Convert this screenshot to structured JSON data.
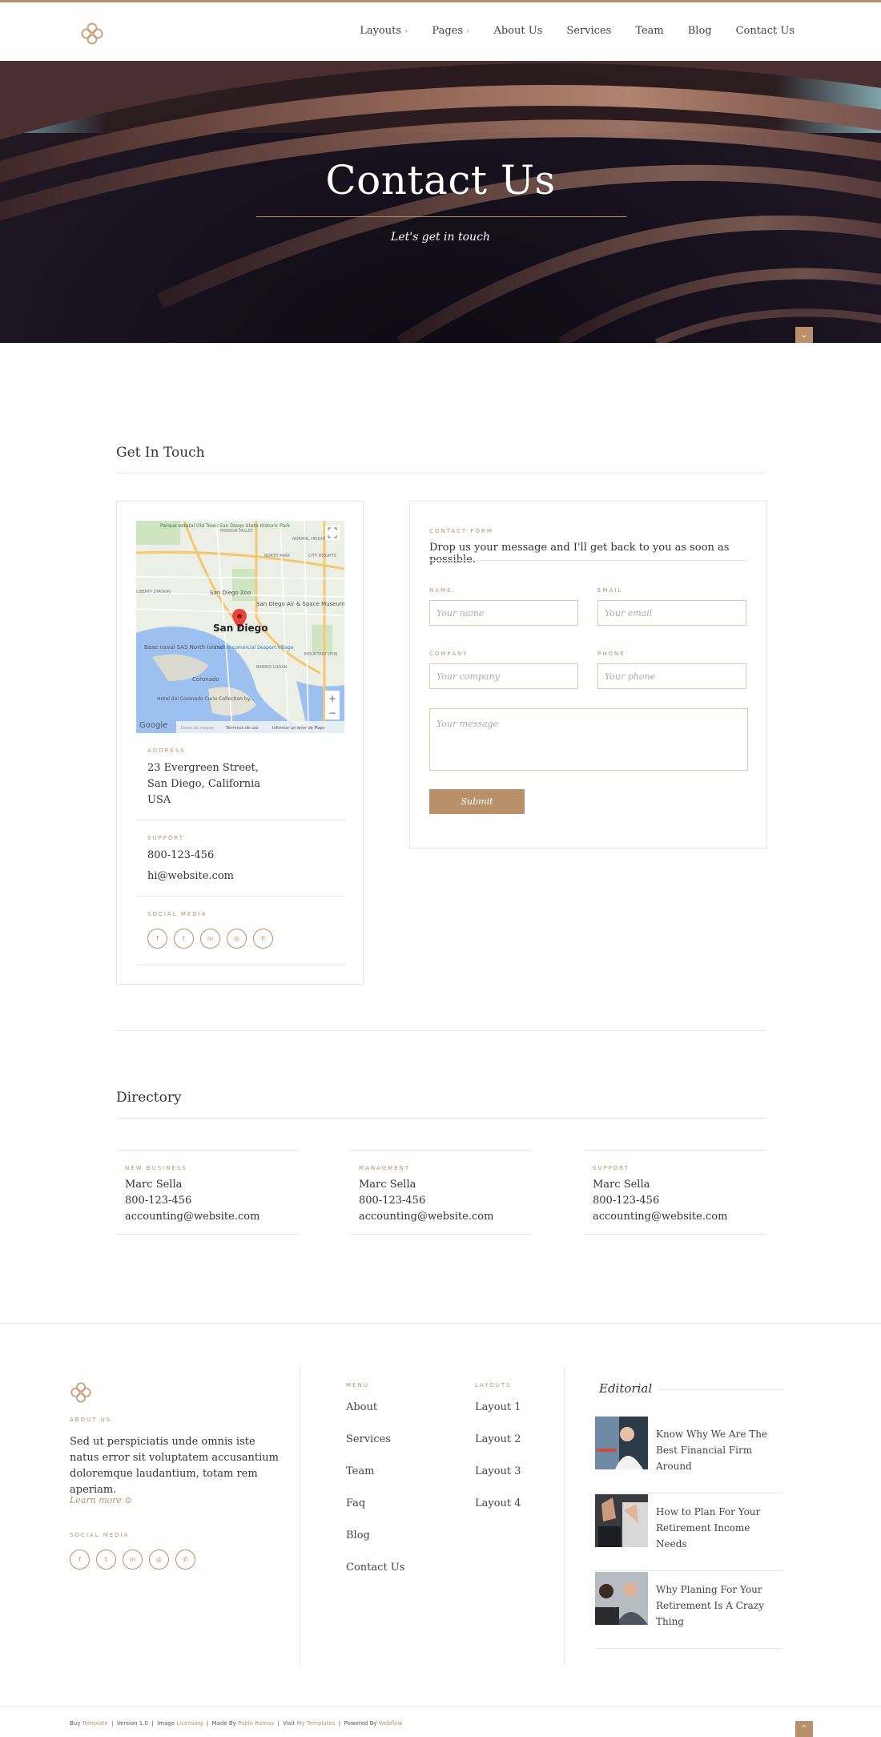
{
  "nav": {
    "items": [
      {
        "label": "Layouts",
        "has_chevron": true
      },
      {
        "label": "Pages",
        "has_chevron": true
      },
      {
        "label": "About Us"
      },
      {
        "label": "Services"
      },
      {
        "label": "Team"
      },
      {
        "label": "Blog"
      },
      {
        "label": "Contact Us"
      }
    ],
    "chevron": "›"
  },
  "hero": {
    "title": "Contact Us",
    "subtitle": "Let's get in touch",
    "down_icon": "chevron-down-icon"
  },
  "get_in_touch": {
    "title": "Get In Touch",
    "map": {
      "city": "San Diego",
      "labels": [
        "Parque estatal Old Town San Diego State Historic Park",
        "MISSION VALLEY",
        "NORMAL HEIGHTS",
        "NORTH PARK",
        "CITY HEIGHTS",
        "LIBERTY STATION",
        "San Diego Zoo",
        "San Diego Air & Space Museum",
        "Base naval SAS North Island",
        "Centro comercial Seaport Village",
        "Coronado",
        "Hotel del Coronado Curio Collection by...",
        "BARRIO LOGAN",
        "MOUNTAIN VIEW"
      ],
      "google": "Google",
      "footer_links": [
        "Datos de mapas",
        "Términos de uso",
        "Informar un error de Maps"
      ],
      "zoom_in": "+",
      "zoom_out": "−"
    },
    "address": {
      "label": "Address",
      "line1": "23 Evergreen Street,",
      "line2": "San Diego, California",
      "line3": "USA"
    },
    "support": {
      "label": "Support",
      "phone": "800-123-456",
      "email": "hi@website.com"
    },
    "social": {
      "label": "Social Media",
      "icons": [
        {
          "name": "facebook-icon",
          "glyph": "f"
        },
        {
          "name": "twitter-icon",
          "glyph": "t"
        },
        {
          "name": "linkedin-icon",
          "glyph": "in"
        },
        {
          "name": "instagram-icon",
          "glyph": "◎"
        },
        {
          "name": "whatsapp-icon",
          "glyph": "✆"
        }
      ]
    }
  },
  "contact_form": {
    "label": "Contact Form",
    "intro": "Drop us your message and I'll get back to you as soon as possible.",
    "name_label": "Name:",
    "name_placeholder": "Your name",
    "email_label": "Email",
    "email_placeholder": "Your email",
    "company_label": "Company",
    "company_placeholder": "Your company",
    "phone_label": "Phone",
    "phone_placeholder": "Your phone",
    "message_placeholder": "Your message",
    "submit": "Submit"
  },
  "directory": {
    "title": "Directory",
    "columns": [
      {
        "label": "New Business",
        "name": "Marc Sella",
        "phone": "800-123-456",
        "email": "accounting@website.com"
      },
      {
        "label": "Managment",
        "name": "Marc Sella",
        "phone": "800-123-456",
        "email": "accounting@website.com"
      },
      {
        "label": "Support",
        "name": "Marc Sella",
        "phone": "800-123-456",
        "email": "accounting@website.com"
      }
    ]
  },
  "footer": {
    "about": {
      "label": "About Us",
      "text": "Sed ut perspiciatis unde omnis iste natus error sit voluptatem accusantium doloremque laudantium, totam rem aperiam.",
      "learn_more": "Learn more ⊙"
    },
    "social_label": "Social Media",
    "menu": {
      "label": "Menu",
      "items": [
        "About",
        "Services",
        "Team",
        "Faq",
        "Blog",
        "Contact Us"
      ]
    },
    "layouts": {
      "label": "Layouts",
      "items": [
        "Layout 1",
        "Layout 2",
        "Layout 3",
        "Layout 4"
      ]
    },
    "editorial": {
      "title": "Editorial",
      "posts": [
        {
          "title": "Know Why We Are The Best Financial Firm Around"
        },
        {
          "title": "How to Plan For Your Retirement Income Needs"
        },
        {
          "title": "Why Planing For Your Retirement Is A Crazy Thing"
        }
      ]
    },
    "credits": {
      "buy": "Buy",
      "template": "Template",
      "version": "Version 1.0",
      "image": "Image",
      "licensing": "Licensing",
      "made_by": "Made By",
      "author": "Pablo Ramos",
      "visit": "Visit",
      "my_templates": "My Templates",
      "powered_by": "Powered By",
      "webflow": "Webflow"
    },
    "up_icon": "chevron-up-icon"
  },
  "colors": {
    "accent": "#b8916a",
    "border": "#e6e6e6",
    "hero_dark": "#14101b"
  }
}
